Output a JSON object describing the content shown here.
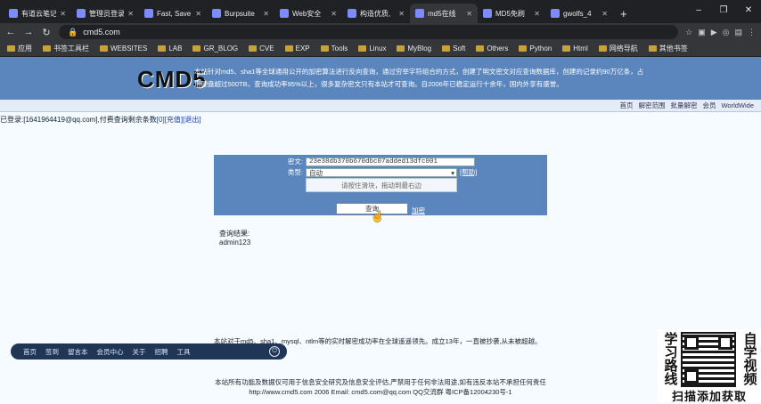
{
  "browser": {
    "tabs": [
      {
        "label": "有道云笔记",
        "icon": "note-icon"
      },
      {
        "label": "管理员登录",
        "icon": "page-icon"
      },
      {
        "label": "Fast, Save",
        "icon": "page-icon"
      },
      {
        "label": "Burpsuite",
        "icon": "page-icon"
      },
      {
        "label": "Web安全",
        "icon": "page-icon"
      },
      {
        "label": "构造优质,",
        "icon": "page-icon"
      },
      {
        "label": "md5在线",
        "icon": "page-icon",
        "active": true
      },
      {
        "label": "MD5免刷",
        "icon": "page-icon"
      },
      {
        "label": "gwolfs_4",
        "icon": "page-icon"
      }
    ],
    "new_tab": "+",
    "url": "cmd5.com",
    "bookmarks": [
      "应用",
      "书签工具栏",
      "WEBSITES",
      "LAB",
      "GR_BLOG",
      "CVE",
      "EXP",
      "Tools",
      "Linux",
      "MyBlog",
      "Soft",
      "Others",
      "Python",
      "Html",
      "网络导航",
      "其他书签"
    ]
  },
  "site": {
    "logo": "CMD5",
    "intro": "本站针对md5、sha1等全球通用公开的加密算法进行反向查询，通过穷举字符组合的方式，创建了明文密文对应查询数据库，创建的记录约90万亿条，占用硬盘超过500TB，查询成功率95%以上，很多复杂密文只有本站才可查询。自2006年已稳定运行十余年，国内外享有盛誉。",
    "subnav": [
      "首页",
      "解密范围",
      "批量解密",
      "会员",
      "WorldWide"
    ],
    "user_line": {
      "prefix": "已登录:",
      "email": "[1641964419@qq.com]",
      "mid": ",付费查询剩余条数",
      "count": "[0]",
      "recharge": "[充值]",
      "logout": "[退出]"
    },
    "form": {
      "hash_label": "密文:",
      "hash_value": "23e38db370b670dbc07added13dfc001",
      "type_label": "类型:",
      "type_value": "自动",
      "help": "[帮助]",
      "captcha": "请按住滑块，拖动到最右边",
      "query_button": "查询",
      "encrypt_link": "加密"
    },
    "result": {
      "label": "查询结果:",
      "value": "admin123"
    },
    "footnote": "本站对于md5、sha1、mysql、ntlm等的实时解密成功率在全球遥遥领先。成立13年，一直被抄袭,从未被超越。",
    "taskbar": [
      "首页",
      "签到",
      "留言本",
      "会员中心",
      "关于",
      "招聘",
      "工具"
    ],
    "footer_line1": "本站所有功能及数据仅可用于信息安全研究及信息安全评估,严禁用于任何非法用途,如有违反本站不承担任何责任",
    "footer_line2": "http://www.cmd5.com 2006    Email: cmd5.com@qq.com    QQ交流群    粤ICP备12004230号-1"
  },
  "promo": {
    "left": [
      "学",
      "习",
      "路",
      "线"
    ],
    "right": [
      "自",
      "学",
      "视",
      "频"
    ],
    "caption": "扫描添加获取"
  }
}
